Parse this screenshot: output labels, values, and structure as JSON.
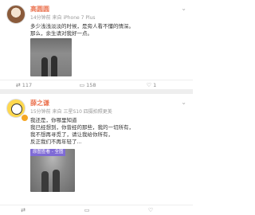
{
  "post1": {
    "username": "高圆圆",
    "meta": "14分钟前 来自 iPhone 7 Plus",
    "lines": [
      "多少浅浅淡淡的时候，是旁人看不懂的情深。",
      "那么，余生请对我好一点。"
    ],
    "actions": {
      "repost_count": "117",
      "comment_count": "158",
      "like_count": "1"
    }
  },
  "post2": {
    "username": "薛之谦",
    "meta": "15分钟前 来自 三星S10 四摄拍照更美",
    "lines": [
      "我还是，你哪里知道",
      "我已经想到，你曾经的那些，我的一切所有，",
      "我不想再寻觅了，请让我给你所有，",
      "反正我们不再年轻了..."
    ],
    "photo_tag": "原图查看 - 全图",
    "actions": {
      "repost_count": "",
      "comment_count": "",
      "like_count": ""
    }
  },
  "icons": {
    "repost": "repost-icon",
    "comment": "comment-icon",
    "like": "like-icon",
    "menu": "chevron-down-icon"
  },
  "colors": {
    "username": "#eb7350",
    "meta": "#999999",
    "tag_bg": "#7f6bd6"
  }
}
